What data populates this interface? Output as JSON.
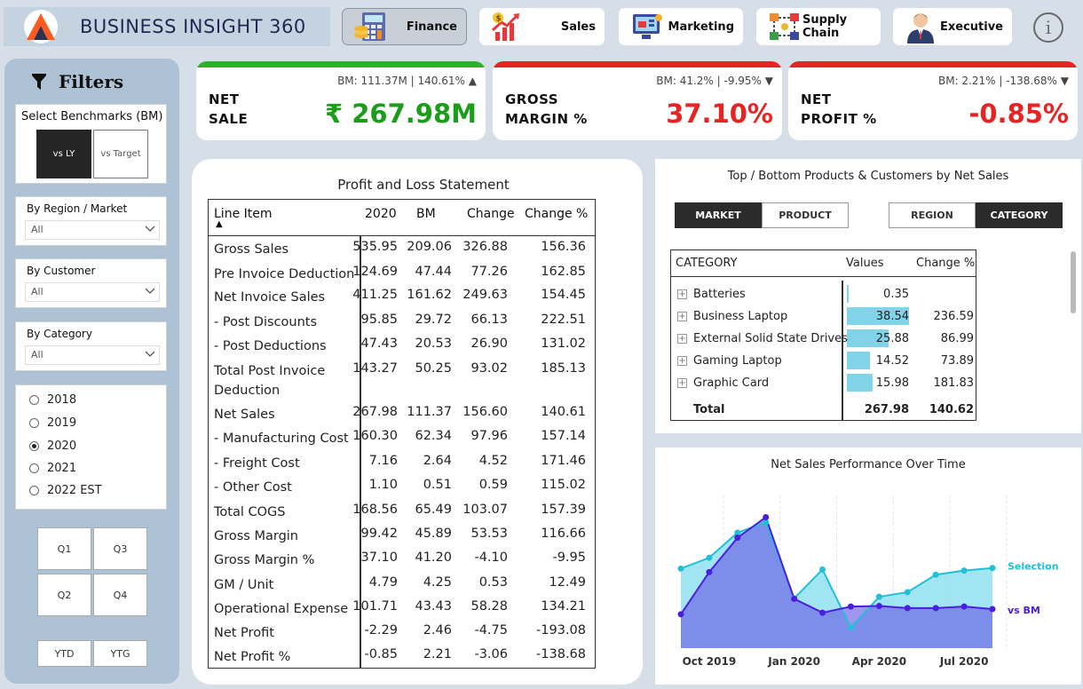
{
  "app": {
    "title": "BUSINESS INSIGHT 360",
    "tabs": [
      {
        "label": "Finance",
        "icon": "calculator-icon",
        "active": true
      },
      {
        "label": "Sales",
        "icon": "growth-chart-icon",
        "active": false
      },
      {
        "label": "Marketing",
        "icon": "marketing-screen-icon",
        "active": false
      },
      {
        "label": "Supply Chain",
        "icon": "supply-chain-icon",
        "active": false
      },
      {
        "label": "Executive",
        "icon": "executive-person-icon",
        "active": false
      }
    ],
    "info_glyph": "i"
  },
  "filters": {
    "title": "Filters",
    "benchmark": {
      "label": "Select Benchmarks (BM)",
      "options": [
        "vs LY",
        "vs Target"
      ],
      "selected": "vs LY"
    },
    "dropdowns": [
      {
        "label": "By Region / Market",
        "value": "All"
      },
      {
        "label": "By Customer",
        "value": "All"
      },
      {
        "label": "By Category",
        "value": "All"
      }
    ],
    "years": [
      "2018",
      "2019",
      "2020",
      "2021",
      "2022 EST"
    ],
    "selected_year": "2020",
    "quarters": [
      "Q1",
      "Q3",
      "Q2",
      "Q4"
    ],
    "periods": [
      "YTD",
      "YTG"
    ]
  },
  "kpis": [
    {
      "name_line1": "NET",
      "name_line2": "SALE",
      "bm": "BM: 111.37M | 140.61%",
      "arrow": "▲",
      "value": "₹ 267.98M",
      "color": "#1a9e1a",
      "bar_color": "#2ab22a"
    },
    {
      "name_line1": "GROSS",
      "name_line2": "MARGIN %",
      "bm": "BM: 41.2% | -9.95%",
      "arrow": "▼",
      "value": "37.10%",
      "color": "#e82323",
      "bar_color": "#e82323"
    },
    {
      "name_line1": "NET",
      "name_line2": "PROFIT %",
      "bm": "BM: 2.21% | -138.68%",
      "arrow": "▼",
      "value": "-0.85%",
      "color": "#e82323",
      "bar_color": "#e82323"
    }
  ],
  "pl": {
    "title": "Profit and Loss Statement",
    "headers": [
      "Line Item",
      "2020",
      "BM",
      "Change",
      "Change %"
    ],
    "sort_glyph": "▲",
    "rows": [
      [
        "Gross Sales",
        "535.95",
        "209.06",
        "326.88",
        "156.36"
      ],
      [
        "Pre Invoice Deduction",
        "124.69",
        "47.44",
        "77.26",
        "162.85"
      ],
      [
        "Net Invoice Sales",
        "411.25",
        "161.62",
        "249.63",
        "154.45"
      ],
      [
        "- Post Discounts",
        "95.85",
        "29.72",
        "66.13",
        "222.51"
      ],
      [
        "- Post Deductions",
        "47.43",
        "20.53",
        "26.90",
        "131.02"
      ],
      [
        "Total Post Invoice Deduction",
        "143.27",
        "50.25",
        "93.02",
        "185.13"
      ],
      [
        "Net Sales",
        "267.98",
        "111.37",
        "156.60",
        "140.61"
      ],
      [
        "- Manufacturing Cost",
        "160.30",
        "62.34",
        "97.96",
        "157.14"
      ],
      [
        "- Freight Cost",
        "7.16",
        "2.64",
        "4.52",
        "171.46"
      ],
      [
        "- Other Cost",
        "1.10",
        "0.51",
        "0.59",
        "115.02"
      ],
      [
        "Total COGS",
        "168.56",
        "65.49",
        "103.07",
        "157.39"
      ],
      [
        "Gross Margin",
        "99.42",
        "45.89",
        "53.53",
        "116.66"
      ],
      [
        "Gross Margin %",
        "37.10",
        "41.20",
        "-4.10",
        "-9.95"
      ],
      [
        "GM / Unit",
        "4.79",
        "4.25",
        "0.53",
        "12.49"
      ],
      [
        "Operational Expense",
        "101.71",
        "43.43",
        "58.28",
        "134.21"
      ],
      [
        "Net Profit",
        "-2.29",
        "2.46",
        "-4.75",
        "-193.08"
      ],
      [
        "Net Profit %",
        "-0.85",
        "2.21",
        "-3.06",
        "-138.68"
      ]
    ]
  },
  "top_bottom": {
    "title": "Top / Bottom Products & Customers by Net Sales",
    "toggle_left": [
      "MARKET",
      "PRODUCT"
    ],
    "toggle_right": [
      "REGION",
      "CATEGORY"
    ],
    "headers": [
      "CATEGORY",
      "Values",
      "Change %"
    ],
    "expand_glyph": "+",
    "rows": [
      {
        "name": "Batteries",
        "value": "0.35",
        "change": "",
        "bar": 0.35
      },
      {
        "name": "Business Laptop",
        "value": "38.54",
        "change": "236.59",
        "bar": 38.54
      },
      {
        "name": "External Solid State Drives",
        "value": "25.88",
        "change": "86.99",
        "bar": 25.88
      },
      {
        "name": "Gaming Laptop",
        "value": "14.52",
        "change": "73.89",
        "bar": 14.52
      },
      {
        "name": "Graphic Card",
        "value": "15.98",
        "change": "181.83",
        "bar": 15.98
      }
    ],
    "total": {
      "label": "Total",
      "value": "267.98",
      "change": "140.62"
    }
  },
  "chart_data": {
    "type": "area",
    "title": "Net Sales Performance Over Time",
    "x": [
      "2019-09",
      "2019-10",
      "2019-11",
      "2019-12",
      "2020-01",
      "2020-02",
      "2020-03",
      "2020-04",
      "2020-05",
      "2020-06",
      "2020-07",
      "2020-08"
    ],
    "x_tick_labels": [
      "Oct 2019",
      "Jan 2020",
      "Apr 2020",
      "Jul 2020"
    ],
    "series": [
      {
        "name": "Selection",
        "values": [
          15.5,
          17.6,
          22.5,
          24.5,
          9.7,
          15.3,
          4.0,
          10.0,
          10.9,
          14.3,
          15.1,
          15.6
        ],
        "color": "#22c0d8"
      },
      {
        "name": "vs BM",
        "values": [
          6.6,
          14.8,
          21.5,
          25.5,
          9.6,
          6.9,
          8.1,
          8.2,
          7.8,
          7.8,
          8.1,
          7.6
        ],
        "color": "#4a1ee0"
      }
    ],
    "ylim": [
      0,
      28
    ],
    "grid": false,
    "legend": "right"
  }
}
